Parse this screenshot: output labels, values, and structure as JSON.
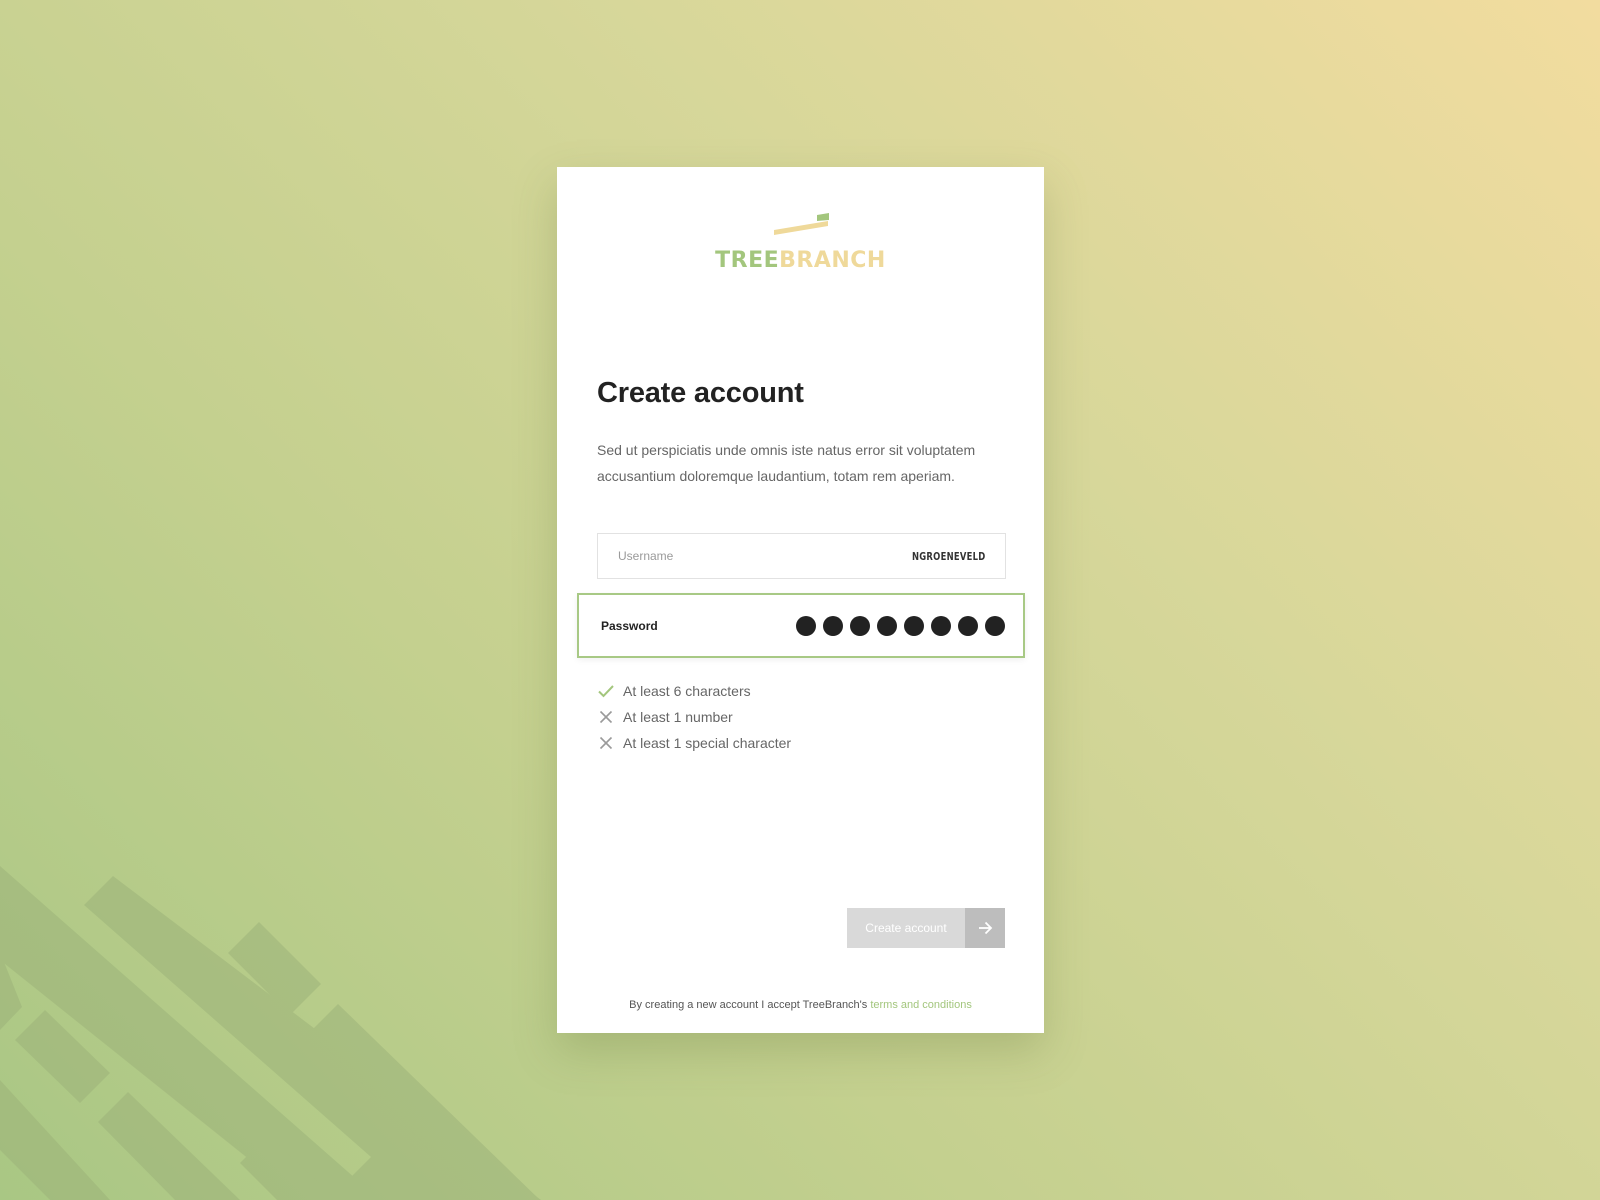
{
  "brand": {
    "name_part1": "TREE",
    "name_part2": "BRANCH",
    "color_primary": "#a3c67d",
    "color_secondary": "#efd99a"
  },
  "form": {
    "title": "Create account",
    "description": "Sed ut perspiciatis unde omnis iste natus error sit voluptatem accusantium doloremque laudantium, totam rem aperiam.",
    "username": {
      "label": "Username",
      "value": "NGROENEVELD"
    },
    "password": {
      "label": "Password",
      "masked_length": 8
    },
    "rules": [
      {
        "text": "At least 6 characters",
        "status": "met",
        "icon": "check-icon"
      },
      {
        "text": "At least 1 number",
        "status": "unmet",
        "icon": "x-icon"
      },
      {
        "text": "At least 1 special character",
        "status": "unmet",
        "icon": "x-icon"
      }
    ],
    "submit_label": "Create account",
    "submit_icon": "arrow-right-icon"
  },
  "footer": {
    "terms_prefix": "By creating a new account I accept TreeBranch's",
    "terms_link": "terms and conditions"
  }
}
